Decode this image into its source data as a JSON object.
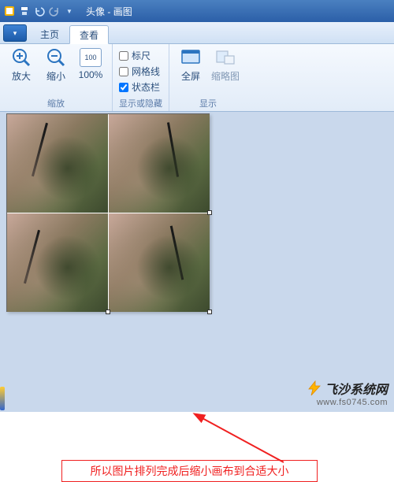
{
  "titlebar": {
    "doc_name": "头像",
    "app_name": "画图"
  },
  "menu": {
    "home": "主页",
    "view": "查看"
  },
  "ribbon": {
    "zoom_in": "放大",
    "zoom_out": "缩小",
    "pct_100": "100%",
    "group_zoom": "缩放",
    "ruler": "标尺",
    "gridlines": "网格线",
    "statusbar": "状态栏",
    "group_show": "显示或隐藏",
    "fullscreen": "全屏",
    "thumbnail": "缩略图",
    "group_display": "显示"
  },
  "annotation": {
    "text": "所以图片排列完成后缩小画布到合适大小"
  },
  "watermark": {
    "name": "飞沙系统网",
    "url": "www.fs0745.com"
  },
  "colors": {
    "accent": "#f02020",
    "ribbon_bg": "#e2ecf8",
    "canvas_bg": "#c9d8ec"
  }
}
